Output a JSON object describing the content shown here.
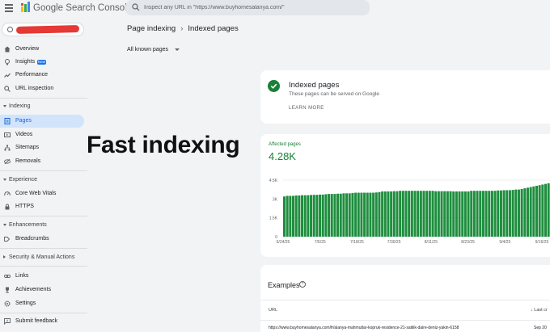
{
  "app": {
    "title": "Google Search Console"
  },
  "search": {
    "placeholder": "Inspect any URL in \"https://www.buyhomesalanya.com/\""
  },
  "sidebar": {
    "top_items": [
      {
        "label": "Overview",
        "icon": "home-icon"
      },
      {
        "label": "Insights",
        "icon": "insights-icon",
        "badge": "New"
      },
      {
        "label": "Performance",
        "icon": "trending-icon"
      },
      {
        "label": "URL inspection",
        "icon": "search-icon"
      }
    ],
    "sections": {
      "indexing": "Indexing",
      "experience": "Experience",
      "enhancements": "Enhancements",
      "security": "Security & Manual Actions"
    },
    "indexing_items": [
      {
        "label": "Pages",
        "icon": "pages-icon",
        "active": true
      },
      {
        "label": "Videos",
        "icon": "video-icon"
      },
      {
        "label": "Sitemaps",
        "icon": "sitemap-icon"
      },
      {
        "label": "Removals",
        "icon": "removals-icon"
      }
    ],
    "experience_items": [
      {
        "label": "Core Web Vitals",
        "icon": "speed-icon"
      },
      {
        "label": "HTTPS",
        "icon": "lock-icon"
      }
    ],
    "enhancements_items": [
      {
        "label": "Breadcrumbs",
        "icon": "breadcrumbs-icon"
      }
    ],
    "bottom_items": [
      {
        "label": "Links",
        "icon": "link-icon"
      },
      {
        "label": "Achievements",
        "icon": "trophy-icon"
      },
      {
        "label": "Settings",
        "icon": "gear-icon"
      }
    ],
    "feedback": "Submit feedback"
  },
  "breadcrumb": {
    "parent": "Page indexing",
    "current": "Indexed pages"
  },
  "filter": {
    "label": "All known pages"
  },
  "overlay": {
    "text": "Fast indexing"
  },
  "indexed_card": {
    "title": "Indexed pages",
    "subtitle": "These pages can be served on Google",
    "link": "LEARN MORE"
  },
  "affected": {
    "label": "Affected pages",
    "value": "4.28K"
  },
  "colors": {
    "green": "#188038",
    "bar": "#1e8e3e",
    "accent": "#1a73e8",
    "active_bg": "#d2e3fc",
    "redaction": "#e53935"
  },
  "chart_data": {
    "type": "bar",
    "title": "",
    "xlabel": "",
    "ylabel": "",
    "ylim": [
      0,
      4500
    ],
    "y_ticks": [
      {
        "value": 4500,
        "label": "4.5K"
      },
      {
        "value": 3000,
        "label": "3K"
      },
      {
        "value": 1500,
        "label": "1.5K"
      },
      {
        "value": 0,
        "label": "0"
      }
    ],
    "x_tick_labels": [
      "6/24/25",
      "7/6/25",
      "7/18/25",
      "7/30/25",
      "8/11/25",
      "8/23/25",
      "9/4/25",
      "9/16/25"
    ],
    "series": [
      {
        "values": [
          3200,
          3250,
          3250,
          3250,
          3280,
          3280,
          3300,
          3300,
          3300,
          3320,
          3330,
          3330,
          3350,
          3350,
          3380,
          3400,
          3400,
          3400,
          3420,
          3420,
          3450,
          3450,
          3450,
          3480,
          3500,
          3500,
          3500,
          3500,
          3500,
          3500,
          3500,
          3520,
          3550,
          3600,
          3600,
          3600,
          3600,
          3620,
          3620,
          3650,
          3650,
          3650,
          3650,
          3650,
          3650,
          3650,
          3650,
          3650,
          3650,
          3650,
          3650,
          3620,
          3620,
          3620,
          3620,
          3620,
          3620,
          3600,
          3600,
          3600,
          3600,
          3600,
          3600,
          3650,
          3650,
          3650,
          3650,
          3650,
          3650,
          3650,
          3650,
          3650,
          3680,
          3680,
          3700,
          3700,
          3700,
          3720,
          3750,
          3750,
          3800,
          3850,
          3900,
          3950,
          4000,
          4050,
          4100,
          4150,
          4200,
          4250,
          4280
        ]
      }
    ]
  },
  "examples": {
    "title": "Examples",
    "col_url": "URL",
    "col_last": "Last cr",
    "rows": [
      {
        "url": "https://www.buyhomesalanya.com/fr/alanya-mahmutlar-kopruk-residence-21-satilik-daire-deniz-yakin-6158",
        "date": "Sep 20"
      }
    ]
  }
}
